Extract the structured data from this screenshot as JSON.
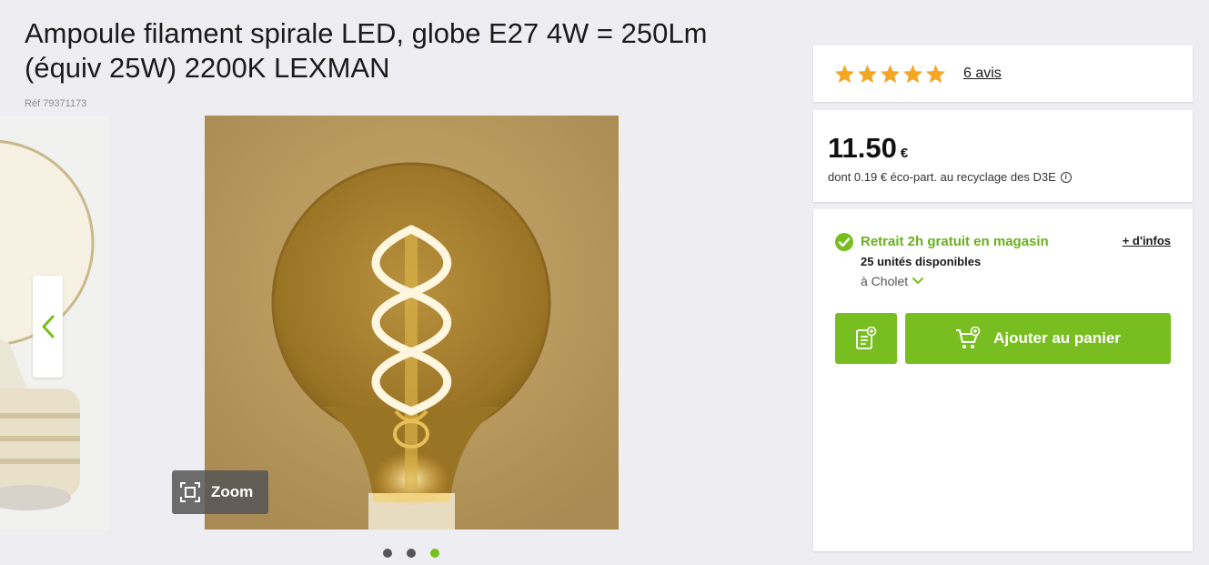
{
  "product": {
    "title": "Ampoule filament spirale LED, globe E27 4W = 250Lm (équiv 25W) 2200K LEXMAN",
    "ref": "Réf 79371173"
  },
  "gallery": {
    "zoom_label": "Zoom",
    "dots_count": 3,
    "active_dot": 3
  },
  "rating": {
    "stars": 5,
    "reviews_label": "6 avis",
    "star_color": "#f5a623"
  },
  "price": {
    "amount": "11.50",
    "currency": "€",
    "eco_text": "dont 0.19 € éco-part. au recyclage des D3E"
  },
  "store": {
    "pickup_label": "Retrait 2h gratuit en magasin",
    "more_info_label": "+ d'infos",
    "stock_label": "25 unités disponibles",
    "location_label": "à Cholet"
  },
  "actions": {
    "add_to_cart_label": "Ajouter au panier"
  },
  "colors": {
    "accent": "#78be20",
    "accent_text": "#6aaf1c"
  }
}
